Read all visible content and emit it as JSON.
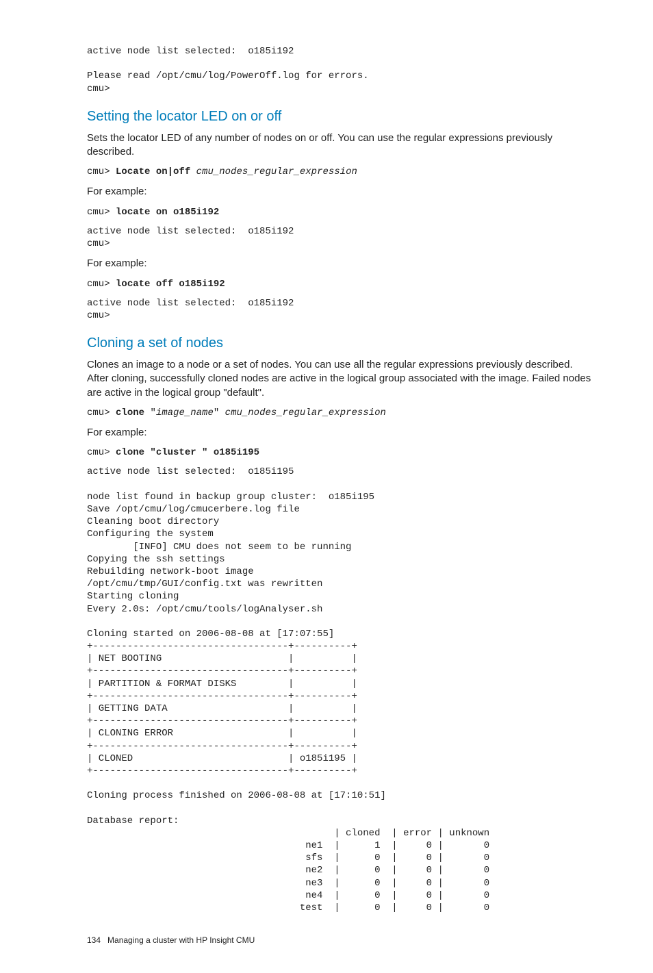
{
  "intro_block": "active node list selected:  o185i192\n\nPlease read /opt/cmu/log/PowerOff.log for errors.\ncmu>",
  "sec1": {
    "heading": "Setting the locator LED on or off",
    "p1": "Sets the locator LED of any number of nodes on or off. You can use the regular expressions previously described.",
    "syntax_prefix": "cmu> ",
    "syntax_bold": "Locate on|off ",
    "syntax_italic": "cmu_nodes_regular_expression",
    "for_example": "For example:",
    "ex1_prefix": "cmu> ",
    "ex1_bold": "locate on o185i192",
    "ex1_out": "active node list selected:  o185i192\ncmu>",
    "ex2_prefix": "cmu> ",
    "ex2_bold": "locate off o185i192",
    "ex2_out": "active node list selected:  o185i192\ncmu>"
  },
  "sec2": {
    "heading": "Cloning a set of nodes",
    "p1": "Clones an image to a node or a set of nodes. You can use all the regular expressions previously described. After cloning, successfully cloned nodes are active in the logical group associated with the image. Failed nodes are active in the logical group \"default\".",
    "syntax_prefix": "cmu> ",
    "syntax_bold": "clone ",
    "syntax_q1": "\"",
    "syntax_italic1": "image_name",
    "syntax_q2": "\" ",
    "syntax_italic2": "cmu_nodes_regular_expression",
    "for_example": "For example:",
    "ex_prefix": "cmu> ",
    "ex_bold": "clone \"cluster \" o185i195",
    "output": "active node list selected:  o185i195\n\nnode list found in backup group cluster:  o185i195\nSave /opt/cmu/log/cmucerbere.log file\nCleaning boot directory\nConfiguring the system\n        [INFO] CMU does not seem to be running\nCopying the ssh settings\nRebuilding network-boot image\n/opt/cmu/tmp/GUI/config.txt was rewritten\nStarting cloning\nEvery 2.0s: /opt/cmu/tools/logAnalyser.sh\n\nCloning started on 2006-08-08 at [17:07:55]\n+----------------------------------+----------+\n| NET BOOTING                      |          |\n+----------------------------------+----------+\n| PARTITION & FORMAT DISKS         |          |\n+----------------------------------+----------+\n| GETTING DATA                     |          |\n+----------------------------------+----------+\n| CLONING ERROR                    |          |\n+----------------------------------+----------+\n| CLONED                           | o185i195 |\n+----------------------------------+----------+\n\nCloning process finished on 2006-08-08 at [17:10:51]\n\nDatabase report:\n                                           | cloned  | error | unknown\n                                      ne1  |      1  |     0 |       0\n                                      sfs  |      0  |     0 |       0\n                                      ne2  |      0  |     0 |       0\n                                      ne3  |      0  |     0 |       0\n                                      ne4  |      0  |     0 |       0\n                                     test  |      0  |     0 |       0"
  },
  "footer": {
    "page": "134",
    "title": "Managing a cluster with HP Insight CMU"
  }
}
